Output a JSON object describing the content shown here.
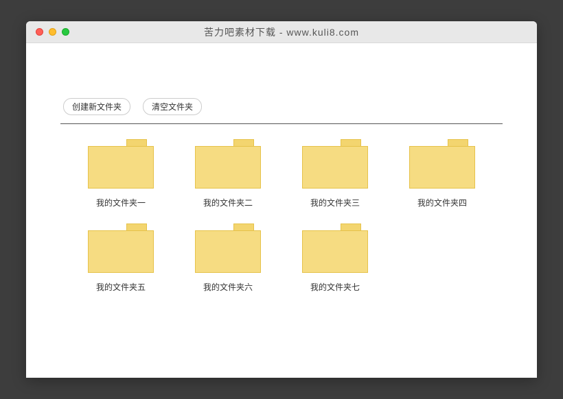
{
  "window": {
    "title": "苦力吧素材下载 - www.kuli8.com"
  },
  "toolbar": {
    "create_label": "创建新文件夹",
    "clear_label": "清空文件夹"
  },
  "folders": [
    {
      "label": "我的文件夹一"
    },
    {
      "label": "我的文件夹二"
    },
    {
      "label": "我的文件夹三"
    },
    {
      "label": "我的文件夹四"
    },
    {
      "label": "我的文件夹五"
    },
    {
      "label": "我的文件夹六"
    },
    {
      "label": "我的文件夹七"
    }
  ]
}
